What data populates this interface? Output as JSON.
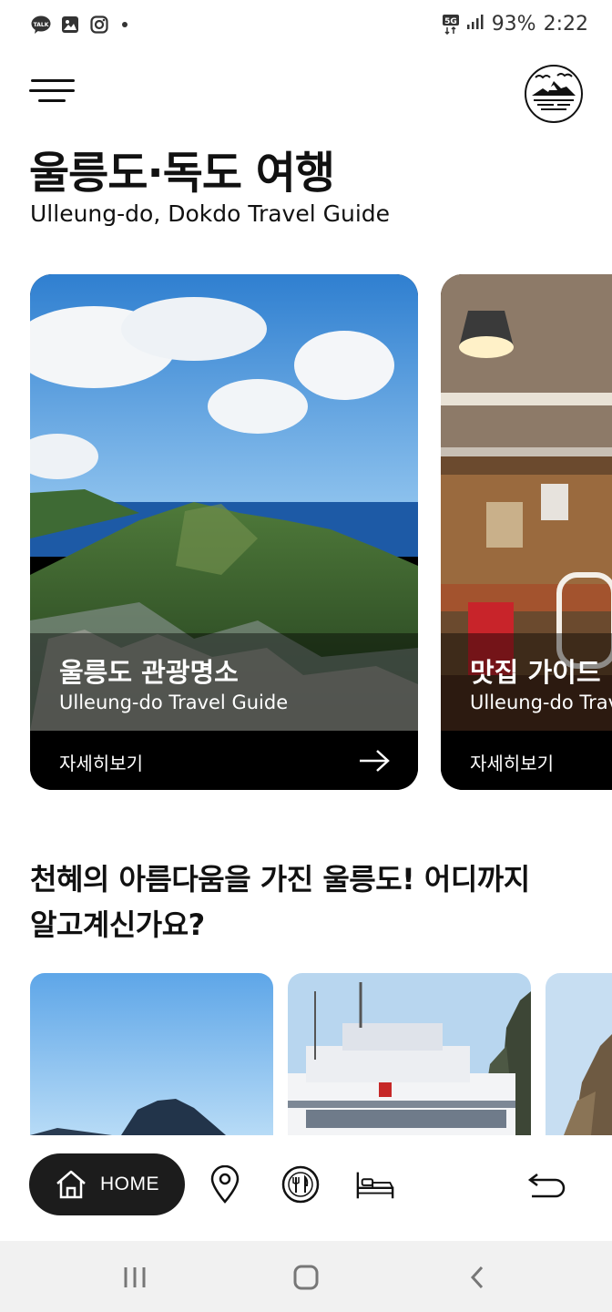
{
  "status_bar": {
    "left_icons": [
      "talk-icon",
      "gallery-icon",
      "instagram-icon",
      "notification-dot-icon"
    ],
    "network": "5G",
    "battery": "93%",
    "time": "2:22"
  },
  "header": {
    "title": "울릉도·독도 여행",
    "subtitle": "Ulleung-do, Dokdo Travel Guide"
  },
  "cards": [
    {
      "title": "울릉도 관광명소",
      "subtitle": "Ulleung-do Travel Guide",
      "more": "자세히보기"
    },
    {
      "title": "맛집 가이드",
      "subtitle": "Ulleung-do Travel Guide",
      "more": "자세히보기"
    }
  ],
  "section": {
    "title_line1": "천혜의 아름다움을 가진 울릉도! 어디까지",
    "title_line2": "알고계신가요?"
  },
  "bottom_nav": {
    "home_label": "HOME",
    "items": [
      "home-icon",
      "location-pin-icon",
      "restaurant-icon",
      "bed-icon",
      "back-arrow-icon"
    ]
  },
  "colors": {
    "text": "#111111",
    "card_bg": "#000000",
    "home_button": "#1c1c1c",
    "system_nav": "#f1f1f1"
  }
}
